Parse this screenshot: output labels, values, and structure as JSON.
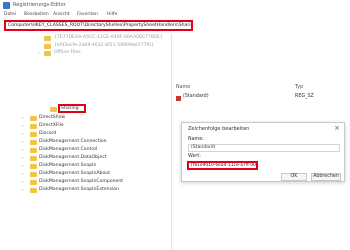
{
  "window": {
    "title": "Registrierungs-Editor"
  },
  "menu": [
    "Datei",
    "Bearbeiten",
    "Ansicht",
    "Favoriten",
    "Hilfe"
  ],
  "address": {
    "path": "Computer\\HKEY_CLASSES_ROOT\\DirectoryShellex\\PropertySheetHandlers\\Sharing"
  },
  "tree": {
    "items": [
      {
        "label": "{7E77DEAA-A5CC-11CE-A40F-00AA00C7760E}",
        "faded": true
      },
      {
        "label": "{ef43ecfe-2ab9-4632-bf21-58909dd177f0}",
        "faded": true
      },
      {
        "label": "Offline Files",
        "faded": true
      },
      {
        "label": "Sharing",
        "faded": false
      },
      {
        "label": "DirectShow",
        "faded": false
      },
      {
        "label": "DirectXFile",
        "faded": false
      },
      {
        "label": "Discord",
        "faded": false
      },
      {
        "label": "DiskManagement.Connection",
        "faded": false
      },
      {
        "label": "DiskManagement.Control",
        "faded": false
      },
      {
        "label": "DiskManagement.DataObject",
        "faded": false
      },
      {
        "label": "DiskManagement.SnapIn",
        "faded": false
      },
      {
        "label": "DiskManagement.SnapInAbout",
        "faded": false
      },
      {
        "label": "DiskManagement.SnapInComponent",
        "faded": false
      },
      {
        "label": "DiskManagement.SnapInExtension",
        "faded": false
      }
    ]
  },
  "values": {
    "header_name": "Name",
    "header_type": "Typ",
    "rows": [
      {
        "name": "(Standard)",
        "type": "REG_SZ"
      }
    ]
  },
  "dialog": {
    "title": "Zeichenfolge bearbeiten",
    "close": "×",
    "name_label": "Name:",
    "name_value": "(Standard)",
    "value_label": "Wert:",
    "value_data": "{f81e9010-6ea4-11ce-a7ff-00aa003ca9f6}",
    "ok_label": "OK",
    "cancel_label": "Abbrechen"
  }
}
